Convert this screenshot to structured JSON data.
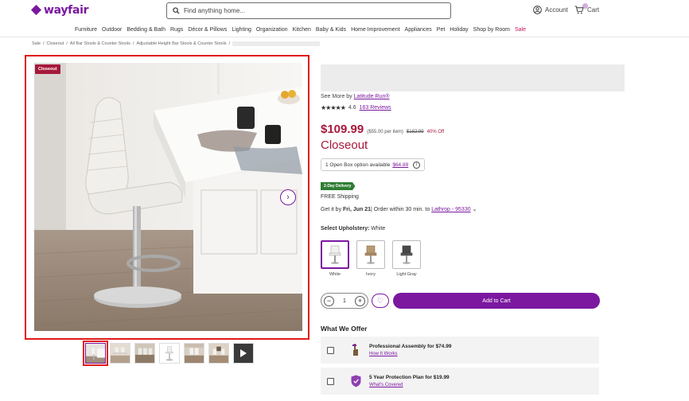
{
  "header": {
    "brand": "wayfair",
    "search_placeholder": "Find anything home...",
    "account_label": "Account",
    "cart_label": "Cart"
  },
  "nav": {
    "items": [
      "Furniture",
      "Outdoor",
      "Bedding & Bath",
      "Rugs",
      "Décor & Pillows",
      "Lighting",
      "Organization",
      "Kitchen",
      "Baby & Kids",
      "Home Improvement",
      "Appliances",
      "Pet",
      "Holiday",
      "Shop by Room"
    ],
    "sale_label": "Sale"
  },
  "breadcrumbs": [
    "Sale",
    "Closeout",
    "All Bar Stools & Counter Stools",
    "Adjustable Height Bar Stools & Counter Stools"
  ],
  "gallery": {
    "badge": "Closeout",
    "next_icon": "chevron-right-icon",
    "thumbnail_count": 7
  },
  "product": {
    "see_more_prefix": "See More by",
    "brand_link": "Latitude Run®",
    "rating_value": "4.6",
    "reviews_link": "163 Reviews",
    "price": "$109.99",
    "per_item": "($55.00 per item)",
    "original_price": "$182.99",
    "percent_off": "40% Off",
    "closeout_label": "Closeout",
    "open_box_text": "1 Open Box option available",
    "open_box_price": "$64.89",
    "delivery_badge": "2-Day Delivery",
    "shipping": "FREE Shipping",
    "get_it_prefix": "Get it by",
    "get_it_date": "Fri, Jun 21",
    "order_within": "| Order within 30 min. to",
    "location_link": "Lathrop - 95330",
    "upholstery_label": "Select Upholstery:",
    "upholstery_value": "White",
    "swatches": [
      "White",
      "Ivory",
      "Light Gray"
    ],
    "quantity": "1",
    "add_to_cart": "Add to Cart"
  },
  "offers": {
    "heading": "What We Offer",
    "items": [
      {
        "title": "Professional Assembly for $74.99",
        "link": "How It Works",
        "icon": "assembly-hand-icon"
      },
      {
        "title": "5 Year Protection Plan for $19.99",
        "link": "What's Covered",
        "icon": "shield-check-icon"
      }
    ]
  },
  "colors": {
    "brand_purple": "#7b189f",
    "sale_red": "#a6193a",
    "delivery_green": "#2e7d32",
    "highlight_red": "#e01a1a"
  }
}
